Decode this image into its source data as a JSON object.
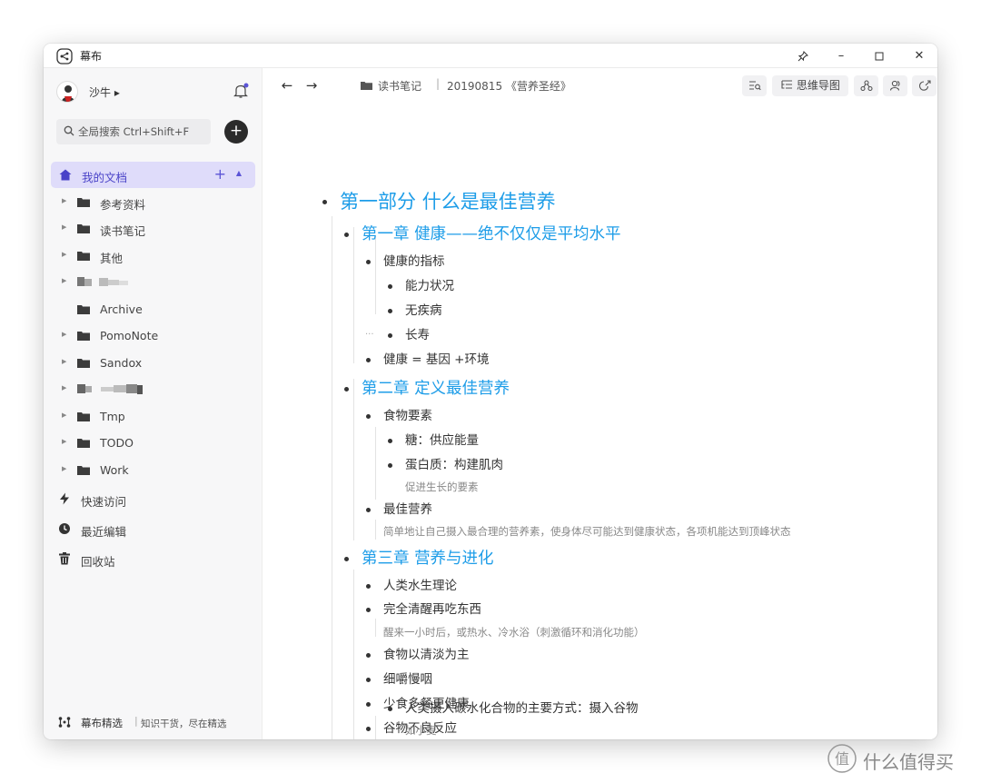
{
  "app": {
    "title": "幕布"
  },
  "user": {
    "name": "沙牛 ▸"
  },
  "search": {
    "placeholder": "全局搜索 Ctrl+Shift+F"
  },
  "sidebar": {
    "my_docs": "我的文档",
    "folders": [
      {
        "label": "参考资料"
      },
      {
        "label": "读书笔记"
      },
      {
        "label": "其他"
      },
      {
        "label": ""
      },
      {
        "label": "Archive"
      },
      {
        "label": "PomoNote"
      },
      {
        "label": "Sandox"
      },
      {
        "label": ""
      },
      {
        "label": "Tmp"
      },
      {
        "label": "TODO"
      },
      {
        "label": "Work"
      }
    ],
    "nav": [
      {
        "label": "快速访问",
        "icon": "lightning-icon"
      },
      {
        "label": "最近编辑",
        "icon": "clock-icon"
      },
      {
        "label": "回收站",
        "icon": "trash-icon"
      }
    ],
    "footer": {
      "name": "幕布精选",
      "separator": "|",
      "slogan": "知识干货，尽在精选"
    }
  },
  "topbar": {
    "breadcrumb_folder": "读书笔记",
    "breadcrumb_separator": "|",
    "breadcrumb_doc": "20190815 《营养圣经》",
    "mindmap_label": "思维导图"
  },
  "outline": {
    "part1": "第一部分 什么是最佳营养",
    "ch1": "第一章 健康——绝不仅仅是平均水平",
    "ch1_a": "健康的指标",
    "ch1_a1": "能力状况",
    "ch1_a2": "无疾病",
    "ch1_a3": "长寿",
    "ch1_b": "健康 = 基因 +环境",
    "ch2": "第二章 定义最佳营养",
    "ch2_a": "食物要素",
    "ch2_a1": "糖：供应能量",
    "ch2_a2": "蛋白质：构建肌肉",
    "ch2_a2_note": "促进生长的要素",
    "ch2_b": "最佳营养",
    "ch2_b_note": "简单地让自己摄入最合理的营养素，使身体尽可能达到健康状态，各项机能达到顶峰状态",
    "ch3": "第三章 营养与进化",
    "ch3_a": "人类水生理论",
    "ch3_b": "完全清醒再吃东西",
    "ch3_b_note": "醒来一小时后，或热水、冷水浴（刺激循环和消化功能）",
    "ch3_c": "食物以清淡为主",
    "ch3_d": "细嚼慢咽",
    "ch3_e": "少食多餐更健康",
    "ch3_f": "谷物不良反应",
    "ch3_f1": "人类摄入碳水化合物的主要方式：摄入谷物",
    "ch3_f1_note": "如小麦"
  },
  "watermark": {
    "text": "什么值得买"
  },
  "colors": {
    "heading": "#1e9de8",
    "accent": "#4a43c8",
    "selected_bg": "#dfdcfa",
    "notify_dot": "#5b54d6"
  }
}
